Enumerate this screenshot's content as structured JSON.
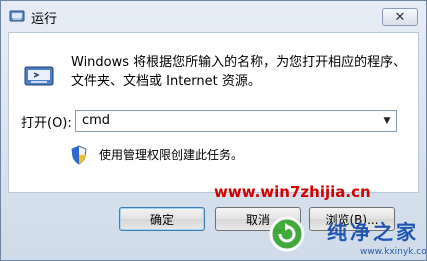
{
  "window": {
    "title": "运行",
    "close": "✕"
  },
  "icons": {
    "title": "run-icon",
    "main": "run-icon",
    "shield": "uac-shield-icon",
    "dropdown": "chevron-down-icon"
  },
  "description": "Windows 将根据您所输入的名称，为您打开相应的程序、\n文件夹、文档或 Internet 资源。",
  "open": {
    "label": "打开(O):",
    "value": "cmd"
  },
  "admin_notice": "使用管理权限创建此任务。",
  "buttons": {
    "ok": "确定",
    "cancel": "取消",
    "browse": "浏览(B)..."
  },
  "watermark": {
    "url": "www.win7zhijia.cn",
    "brand": "纯净之家",
    "site": "www.kxinyk.com"
  },
  "colors": {
    "watermark_red": "#d10000",
    "accent_blue": "#1f56b4"
  }
}
